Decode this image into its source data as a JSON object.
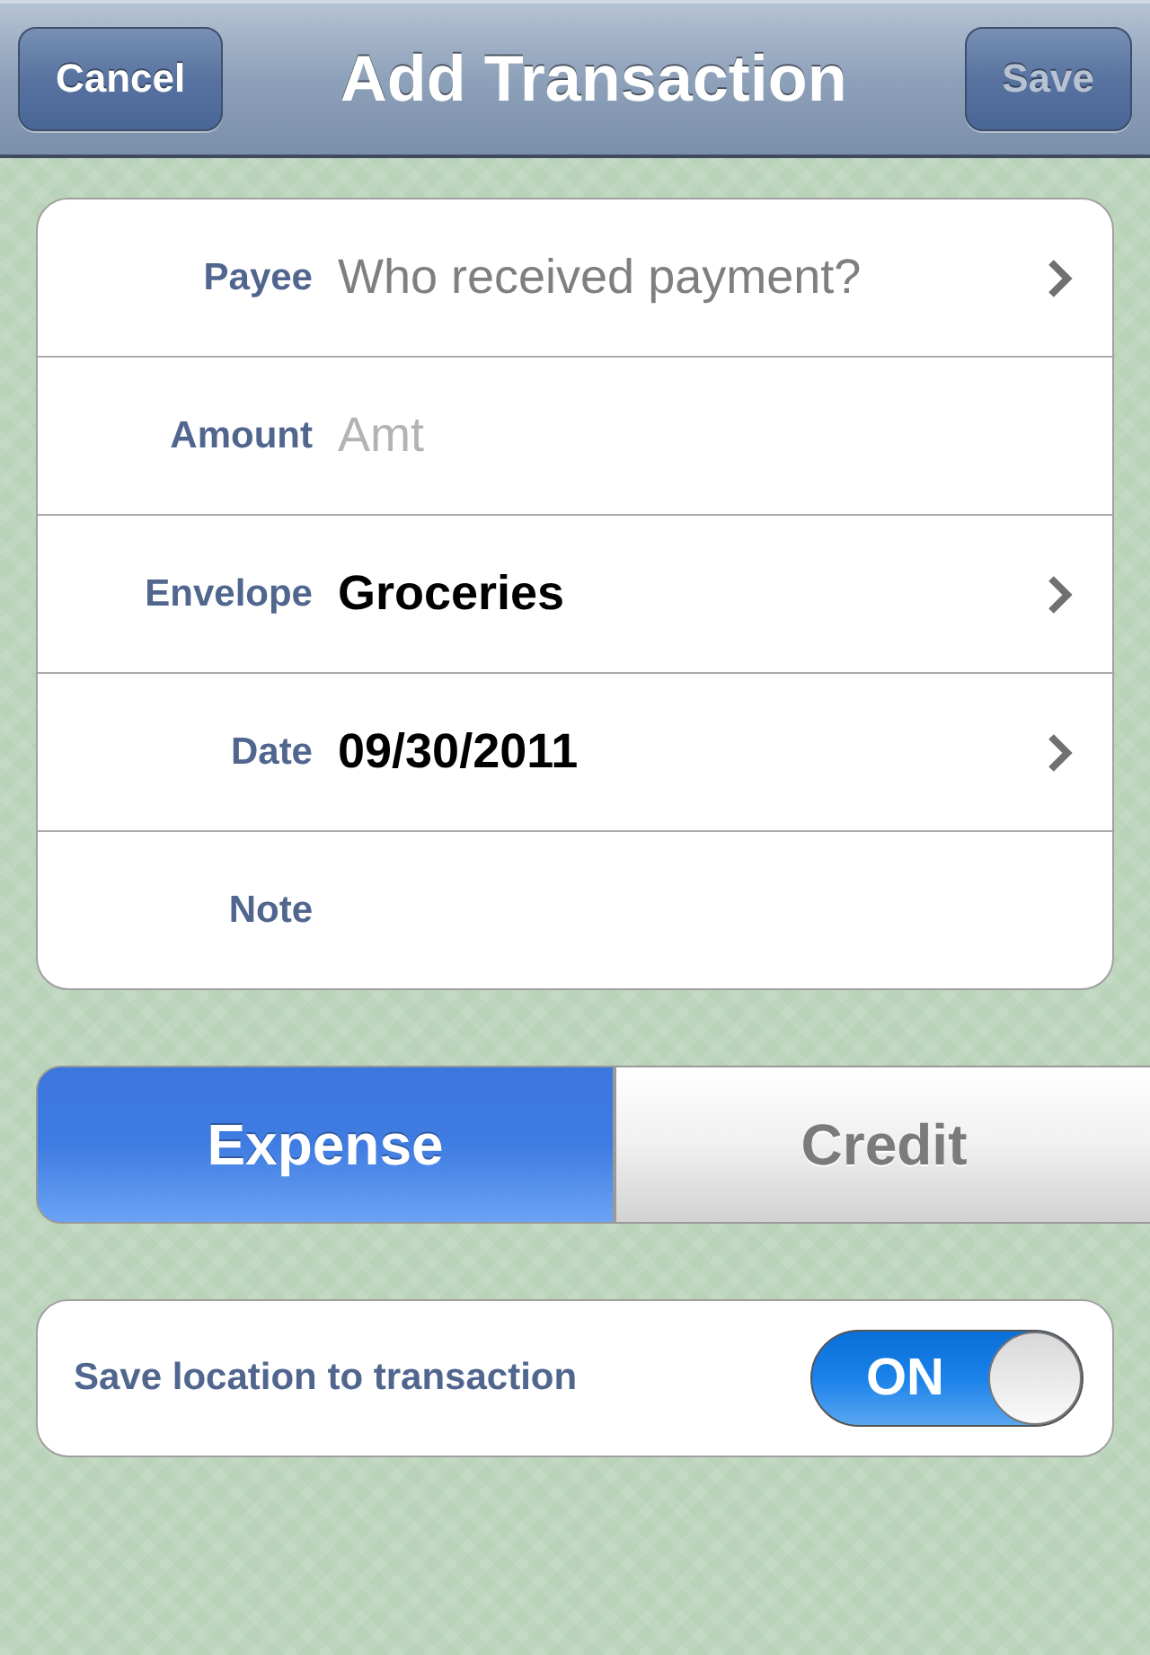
{
  "nav_bar": {
    "title": "Add Transaction",
    "left_button": {
      "label": "Cancel",
      "disabled": false
    },
    "right_button": {
      "label": "Save",
      "disabled": true
    }
  },
  "fields": [
    {
      "label": "Payee",
      "kind": "picker",
      "placeholder": "Who received payment?",
      "disclosure": true
    },
    {
      "label": "Amount",
      "kind": "input",
      "placeholder": "Amt",
      "disclosure": false
    },
    {
      "label": "Envelope",
      "kind": "picker",
      "value": "Groceries",
      "disclosure": true
    },
    {
      "label": "Date",
      "kind": "picker",
      "value": "09/30/2011",
      "disclosure": true
    },
    {
      "label": "Note",
      "kind": "input",
      "disclosure": false
    }
  ],
  "segments": [
    {
      "label": "Expense",
      "selected": true
    },
    {
      "label": "Credit",
      "selected": false
    }
  ],
  "location_toggle": {
    "label": "Save location to transaction",
    "on": true,
    "state_text": "ON"
  }
}
